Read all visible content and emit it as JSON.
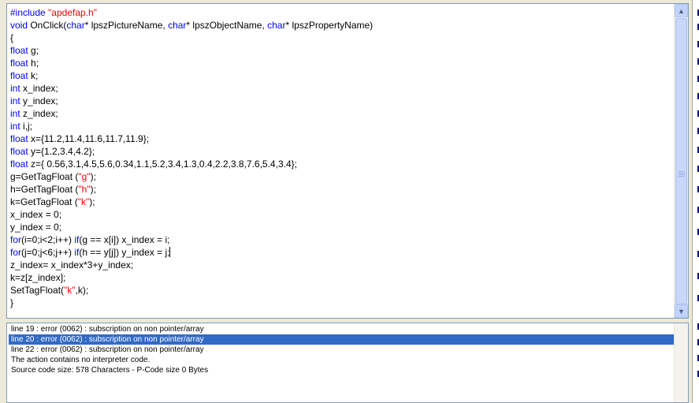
{
  "editor": {
    "lines": [
      [
        {
          "t": "#include ",
          "c": "pp"
        },
        {
          "t": "\"apdefap.h\"",
          "c": "str"
        }
      ],
      [
        {
          "t": "void",
          "c": "kw"
        },
        {
          "t": " OnClick("
        },
        {
          "t": "char",
          "c": "kw"
        },
        {
          "t": "* lpszPictureName, "
        },
        {
          "t": "char",
          "c": "kw"
        },
        {
          "t": "* lpszObjectName, "
        },
        {
          "t": "char",
          "c": "kw"
        },
        {
          "t": "* lpszPropertyName)"
        }
      ],
      [
        {
          "t": "{"
        }
      ],
      [
        {
          "t": "float",
          "c": "kw"
        },
        {
          "t": " g;"
        }
      ],
      [
        {
          "t": "float",
          "c": "kw"
        },
        {
          "t": " h;"
        }
      ],
      [
        {
          "t": "float",
          "c": "kw"
        },
        {
          "t": " k;"
        }
      ],
      [
        {
          "t": "int",
          "c": "kw"
        },
        {
          "t": " x_index;"
        }
      ],
      [
        {
          "t": "int",
          "c": "kw"
        },
        {
          "t": " y_index;"
        }
      ],
      [
        {
          "t": "int",
          "c": "kw"
        },
        {
          "t": " z_index;"
        }
      ],
      [
        {
          "t": "int",
          "c": "kw"
        },
        {
          "t": " i,j;"
        }
      ],
      [
        {
          "t": "float",
          "c": "kw"
        },
        {
          "t": " x={11.2,11.4,11.6,11.7,11.9};"
        }
      ],
      [
        {
          "t": "float",
          "c": "kw"
        },
        {
          "t": " y={1.2,3.4,4.2};"
        }
      ],
      [
        {
          "t": "float",
          "c": "kw"
        },
        {
          "t": " z={ 0.56,3.1,4.5,5.6,0.34,1.1,5.2,3.4,1.3,0.4,2.2,3.8,7.6,5.4,3.4};"
        }
      ],
      [
        {
          "t": "g=GetTagFloat ("
        },
        {
          "t": "\"g\"",
          "c": "str"
        },
        {
          "t": ");"
        }
      ],
      [
        {
          "t": "h=GetTagFloat ("
        },
        {
          "t": "\"h\"",
          "c": "str"
        },
        {
          "t": ");"
        }
      ],
      [
        {
          "t": "k=GetTagFloat ("
        },
        {
          "t": "\"k\"",
          "c": "str"
        },
        {
          "t": ");"
        }
      ],
      [
        {
          "t": "x_index = 0;"
        }
      ],
      [
        {
          "t": "y_index = 0;"
        }
      ],
      [
        {
          "t": "for",
          "c": "kw"
        },
        {
          "t": "(i=0;i<2;i++) "
        },
        {
          "t": "if",
          "c": "kw"
        },
        {
          "t": "(g == x[i]) x_index = i;"
        }
      ],
      [
        {
          "t": "for",
          "c": "kw"
        },
        {
          "t": "(j=0;j<6;j++) "
        },
        {
          "t": "if",
          "c": "kw"
        },
        {
          "t": "(h == y[j]) y_index = j;"
        },
        {
          "caret": true
        }
      ],
      [
        {
          "t": "z_index= x_index*3+y_index;"
        }
      ],
      [
        {
          "t": "k=z[z_index];"
        }
      ],
      [
        {
          "t": "SetTagFloat("
        },
        {
          "t": "\"k\"",
          "c": "str"
        },
        {
          "t": ",k);"
        }
      ],
      [
        {
          "t": "}"
        }
      ]
    ]
  },
  "output": {
    "items": [
      {
        "text": "line 19 : error (0062) : subscription on non pointer/array",
        "selected": false
      },
      {
        "text": "line 20 : error (0062) : subscription on non pointer/array",
        "selected": true
      },
      {
        "text": "line 22 : error (0062) : subscription on non pointer/array",
        "selected": false
      },
      {
        "text": "The action contains no interpreter code.",
        "selected": false
      },
      {
        "text": "Source code size: 578 Characters - P-Code size 0 Bytes",
        "selected": false
      }
    ]
  },
  "icons": {
    "scroll_up": "▲",
    "scroll_down": "▼"
  },
  "colors": {
    "keyword": "#0000ff",
    "string": "#ff0000",
    "selection": "#316ac5"
  }
}
